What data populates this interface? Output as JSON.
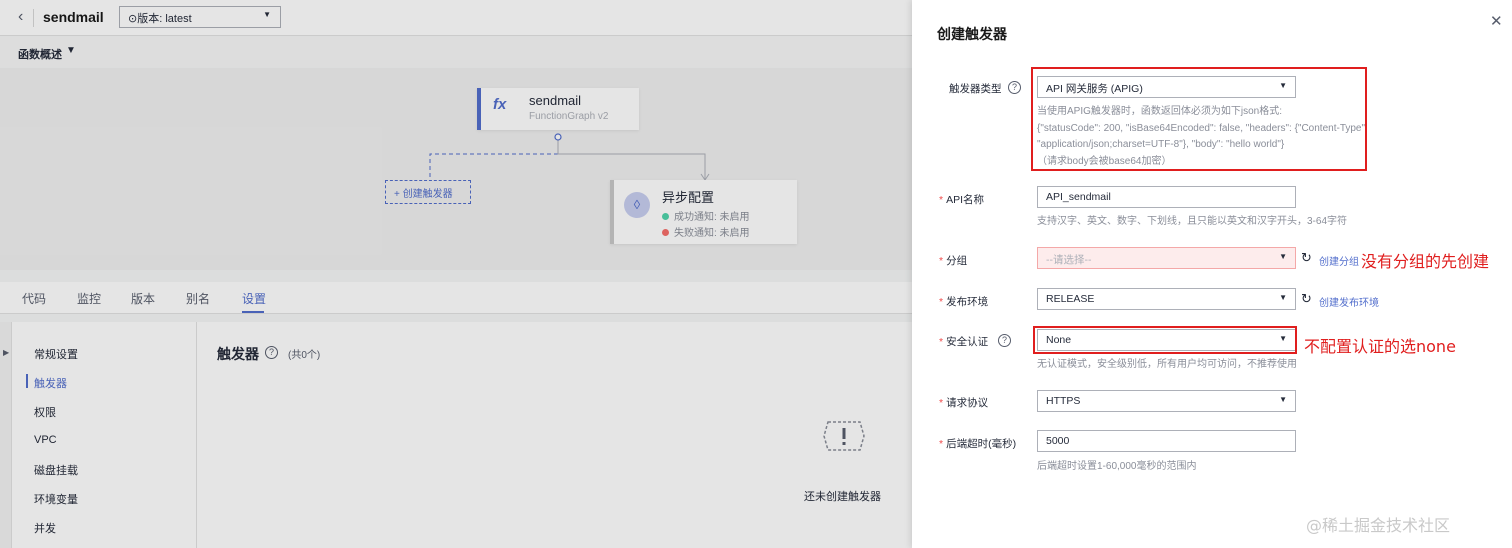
{
  "topbar": {
    "function_name": "sendmail",
    "version_select": "⊙版本: latest"
  },
  "overview": {
    "label": "函数概述"
  },
  "diagram": {
    "function_node_name": "sendmail",
    "function_node_runtime": "FunctionGraph v2",
    "add_trigger_label": "创建触发器",
    "async_title": "异步配置",
    "async_success": "成功通知: 未启用",
    "async_failure": "失败通知: 未启用"
  },
  "tabs": [
    "代码",
    "监控",
    "版本",
    "别名",
    "设置"
  ],
  "settings_nav": [
    "常规设置",
    "触发器",
    "权限",
    "VPC",
    "磁盘挂载",
    "环境变量",
    "并发"
  ],
  "trigger_panel": {
    "title": "触发器",
    "count": "(共0个)",
    "empty_text": "还未创建触发器"
  },
  "drawer": {
    "title": "创建触发器",
    "trigger_type": {
      "label": "触发器类型",
      "value": "API 网关服务 (APIG)",
      "hint_lines": [
        "当使用APIG触发器时，函数返回体必须为如下json格式:",
        "{\"statusCode\": 200, \"isBase64Encoded\": false, \"headers\": {\"Content-Type\":",
        "\"application/json;charset=UTF-8\"}, \"body\": \"hello world\"}",
        "（请求body会被base64加密）"
      ]
    },
    "api_name": {
      "label": "API名称",
      "value": "API_sendmail",
      "hint": "支持汉字、英文、数字、下划线，且只能以英文和汉字开头，3-64字符"
    },
    "group": {
      "label": "分组",
      "placeholder": "--请选择--",
      "link": "创建分组"
    },
    "env": {
      "label": "发布环境",
      "value": "RELEASE",
      "link": "创建发布环境"
    },
    "auth": {
      "label": "安全认证",
      "value": "None",
      "hint": "无认证模式，安全级别低，所有用户均可访问，不推荐使用"
    },
    "protocol": {
      "label": "请求协议",
      "value": "HTTPS"
    },
    "timeout": {
      "label": "后端超时(毫秒)",
      "value": "5000",
      "hint": "后端超时设置1-60,000毫秒的范围内"
    }
  },
  "annotations": {
    "group_note": "没有分组的先创建",
    "auth_note": "不配置认证的选none"
  },
  "watermark": "@稀土掘金技术社区",
  "colors": {
    "accent": "#526ecc",
    "annotation_red": "#e01e1e",
    "error_bg": "#fdecec"
  }
}
